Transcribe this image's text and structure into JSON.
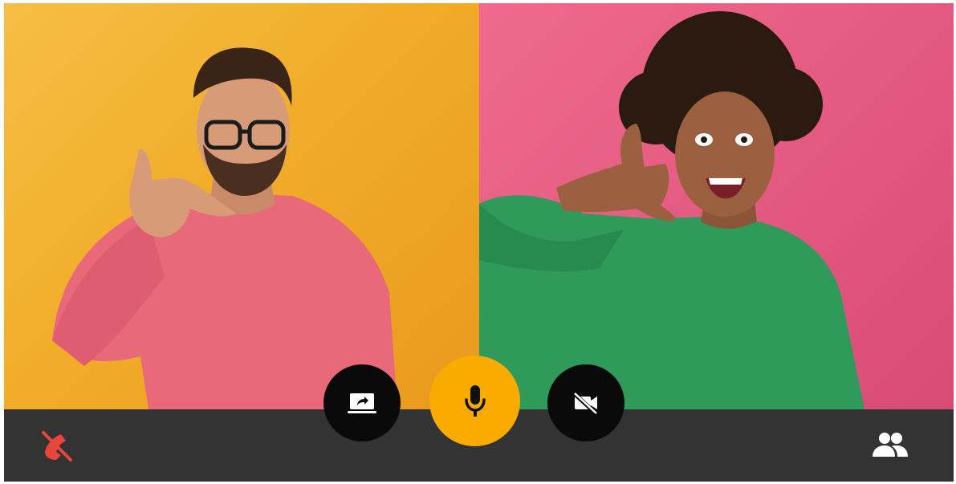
{
  "call": {
    "participants": [
      {
        "name": "man-in-pink-sweater",
        "background_color": "#f1ad2a",
        "sweater_color": "#e8697a"
      },
      {
        "name": "woman-in-green-sweater",
        "background_color": "#e45b82",
        "sweater_color": "#2f9a5a"
      }
    ]
  },
  "controls": {
    "bar_color": "#333333",
    "share_screen": {
      "icon": "share-screen-icon",
      "bg": "#0a0a0a"
    },
    "microphone": {
      "icon": "mic-icon",
      "bg": "#f9ab00"
    },
    "camera": {
      "icon": "camera-off-icon",
      "bg": "#0a0a0a"
    },
    "hang_up": {
      "icon": "hang-up-icon",
      "color": "#e8453c"
    },
    "participants": {
      "icon": "people-icon",
      "color": "#ffffff"
    }
  }
}
